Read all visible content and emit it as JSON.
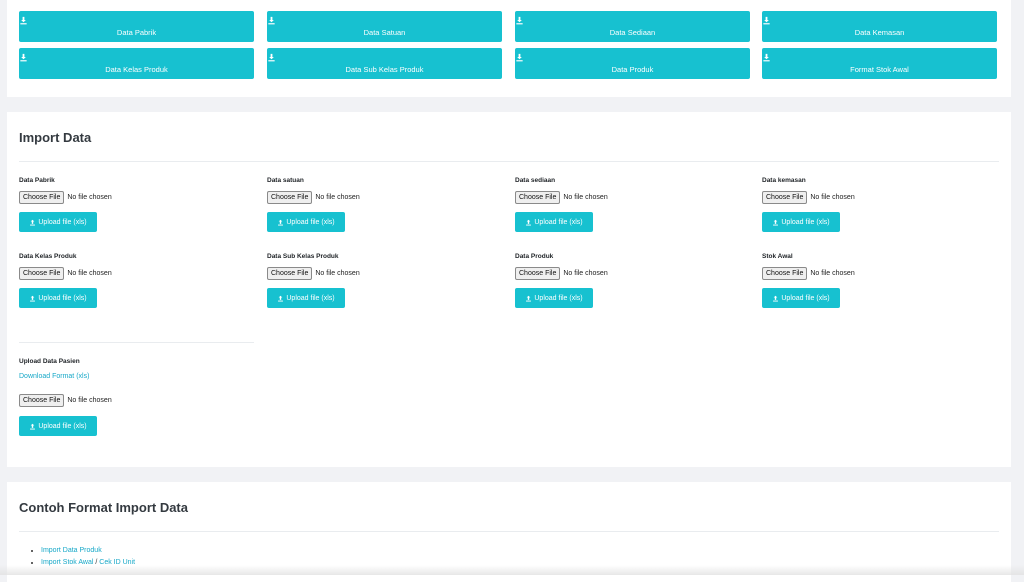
{
  "colors": {
    "accent": "#17c1d0",
    "link": "#17a8c8",
    "background": "#f1f2f5"
  },
  "download_buttons": [
    {
      "label": "Data Pabrik",
      "icon": "download-icon"
    },
    {
      "label": "Data Satuan",
      "icon": "download-icon"
    },
    {
      "label": "Data Sediaan",
      "icon": "download-icon"
    },
    {
      "label": "Data Kemasan",
      "icon": "download-icon"
    },
    {
      "label": "Data Kelas Produk",
      "icon": "download-icon"
    },
    {
      "label": "Data Sub Kelas Produk",
      "icon": "download-icon"
    },
    {
      "label": "Data Produk",
      "icon": "download-icon"
    },
    {
      "label": "Format Stok Awal",
      "icon": "download-icon"
    }
  ],
  "import": {
    "title": "Import Data",
    "choose_label": "Choose File",
    "no_file_label": "No file chosen",
    "upload_label": "Upload file (xls)",
    "upload_icon": "upload-icon",
    "fields": [
      {
        "label": "Data Pabrik"
      },
      {
        "label": "Data satuan"
      },
      {
        "label": "Data sediaan"
      },
      {
        "label": "Data kemasan"
      },
      {
        "label": "Data Kelas Produk"
      },
      {
        "label": "Data Sub Kelas Produk"
      },
      {
        "label": "Data Produk"
      },
      {
        "label": "Stok Awal"
      }
    ],
    "pasien": {
      "label": "Upload Data Pasien",
      "format_link": "Download Format (xls)"
    }
  },
  "example": {
    "title": "Contoh Format Import Data",
    "items": [
      {
        "link": "Import Data Produk"
      },
      {
        "link": "Import Stok Awal",
        "separator": "/",
        "extra_link": "Cek ID Unit"
      }
    ]
  }
}
